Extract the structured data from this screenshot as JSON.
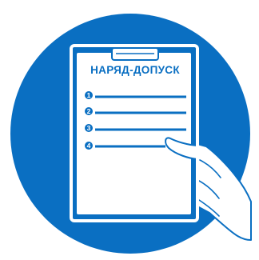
{
  "sign": {
    "document_title": "НАРЯД-ДОПУСК",
    "list_markers": [
      "1",
      "2",
      "3",
      "4"
    ],
    "colors": {
      "circle": "#0a6fc2",
      "outline": "#ffffff",
      "ink": "#0a6fc2",
      "background": "#ffffff"
    },
    "icons": {
      "document": "clipboard-icon",
      "hand": "hand-icon"
    }
  }
}
